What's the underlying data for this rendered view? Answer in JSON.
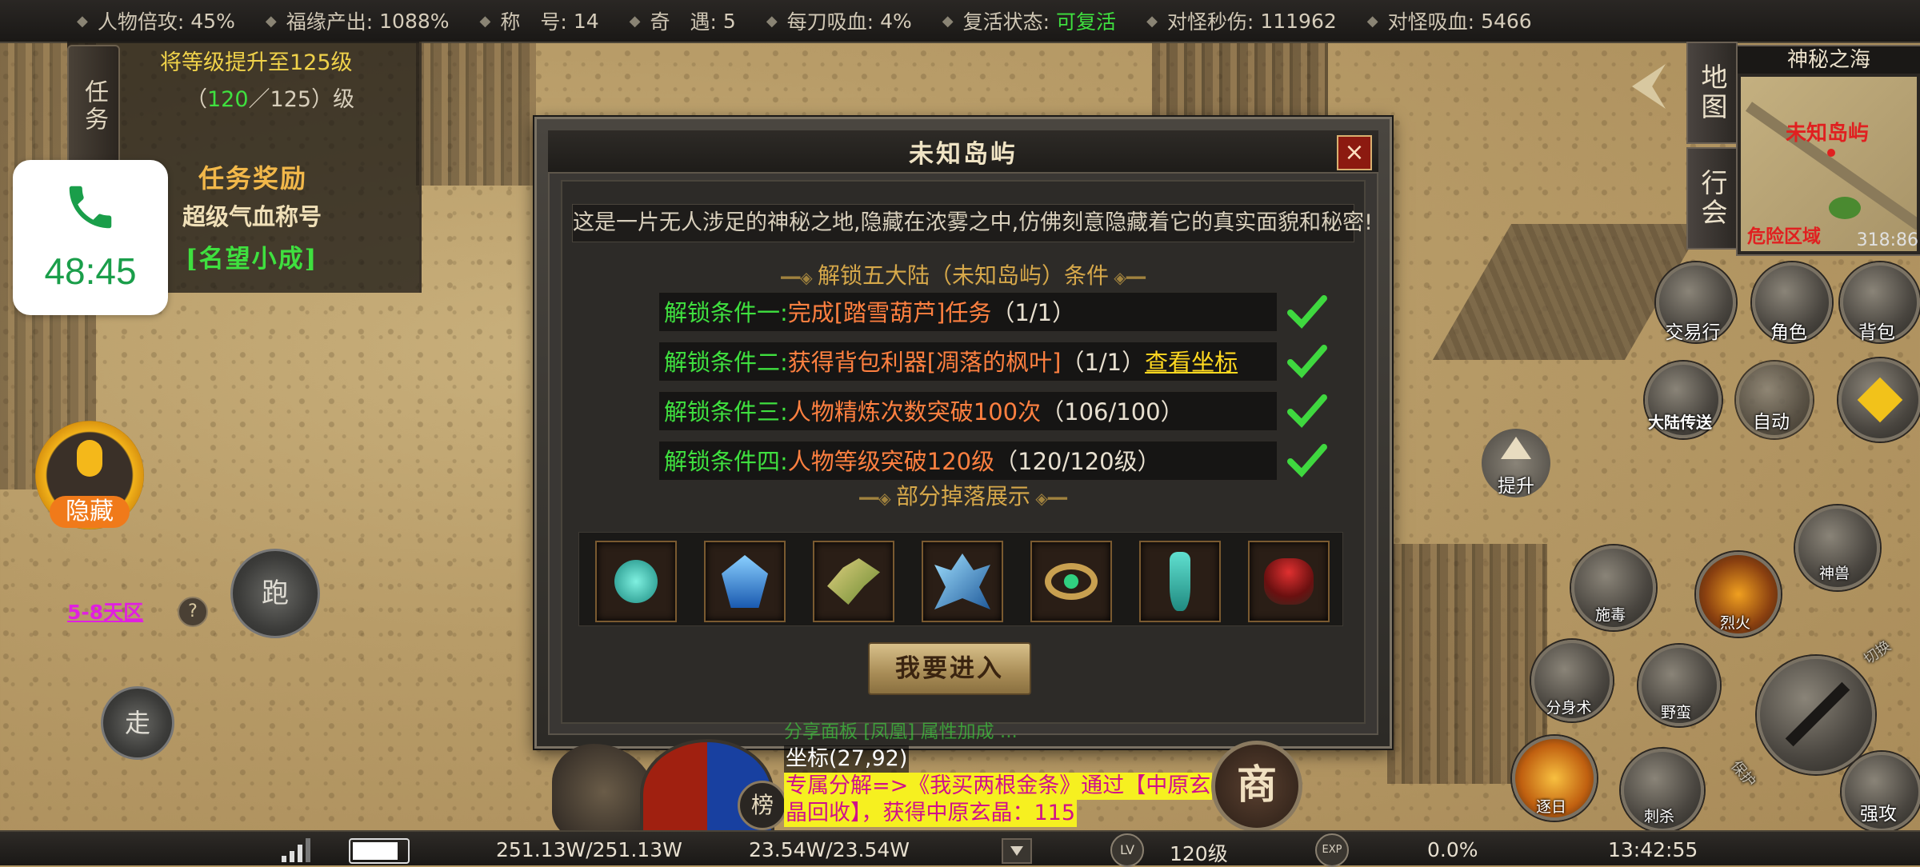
{
  "top_stats": [
    {
      "label": "人物倍攻:",
      "value": "45%",
      "color": ""
    },
    {
      "label": "福缘产出:",
      "value": "1088%",
      "color": ""
    },
    {
      "label": "称　号:",
      "value": "14",
      "color": ""
    },
    {
      "label": "奇　遇:",
      "value": "5",
      "color": ""
    },
    {
      "label": "每刀吸血:",
      "value": "4%",
      "color": ""
    },
    {
      "label": "复活状态:",
      "value": "可复活",
      "color": "green"
    },
    {
      "label": "对怪秒伤:",
      "value": "111962",
      "color": ""
    },
    {
      "label": "对怪吸血:",
      "value": "5466",
      "color": ""
    }
  ],
  "quest": {
    "tab_label": "任务",
    "goal": "将等级提升至125级",
    "progress_open": "（",
    "progress_current": "120",
    "progress_rest": "／125）级",
    "reward_header": "任务奖励",
    "reward_title": "超级气血称号",
    "reward_name": "[名望小成]"
  },
  "call": {
    "time": "48:45"
  },
  "controls": {
    "hide_label": "隐藏",
    "run_label": "跑",
    "walk_label": "走",
    "zone_link": "5-8天区",
    "help": "?"
  },
  "dialog": {
    "title": "未知岛屿",
    "close": "×",
    "description": "这是一片无人涉足的神秘之地,隐藏在浓雾之中,仿佛刻意隐藏着它的真实面貌和秘密!",
    "unlock_header": "解锁五大陆（未知岛屿）条件",
    "conditions": [
      {
        "key": "解锁条件一:",
        "text": "完成[踏雪葫芦]任务",
        "progress": "（1/1）",
        "link": ""
      },
      {
        "key": "解锁条件二:",
        "text": "获得背包利器[凋落的枫叶]",
        "progress": "（1/1）",
        "link": "查看坐标"
      },
      {
        "key": "解锁条件三:",
        "text": "人物精炼次数突破100次",
        "progress": "（106/100）",
        "link": ""
      },
      {
        "key": "解锁条件四:",
        "text": "人物等级突破120级",
        "progress": "（120/120级）",
        "link": ""
      }
    ],
    "drops_header": "部分掉落展示",
    "drop_items": [
      "teal-orb-item-icon",
      "blue-crystal-item-icon",
      "jade-dragon-item-icon",
      "ice-wing-item-icon",
      "emerald-ring-item-icon",
      "jade-vase-item-icon",
      "red-pot-item-icon"
    ],
    "enter_button": "我要进入"
  },
  "minimap": {
    "map_button": "地图",
    "guild_button": "行会",
    "area_name": "神秘之海",
    "location_label": "未知岛屿",
    "danger_label": "危险区域",
    "coords": "318:86"
  },
  "skills": {
    "trade": "交易行",
    "character": "角色",
    "bag": "背包",
    "teleport": "大陆传送",
    "auto": "自动",
    "upgrade": "提升",
    "beast": "神兽",
    "poison": "施毒",
    "fire": "烈火",
    "clone": "分身术",
    "savage": "野蛮",
    "expel": "逐日",
    "slay": "刺杀",
    "attack": "强攻",
    "switch": "切换",
    "guard": "保护"
  },
  "chat": {
    "line0": "分享面板 [凤凰] 属性加成 ...",
    "line1": "坐标(27,92)",
    "line2": "专属分解=>《我买两根金条》通过【中原玄",
    "line3": "晶回收】，获得中原玄晶：115"
  },
  "hud": {
    "rank_button": "榜",
    "shop_button": "商"
  },
  "bottom_bar": {
    "battery_level": 0.85,
    "hp": "251.13W/251.13W",
    "mp": "23.54W/23.54W",
    "lv_badge": "LV",
    "level": "120级",
    "exp_badge": "EXP",
    "exp": "0.0%",
    "clock": "13:42:55"
  }
}
